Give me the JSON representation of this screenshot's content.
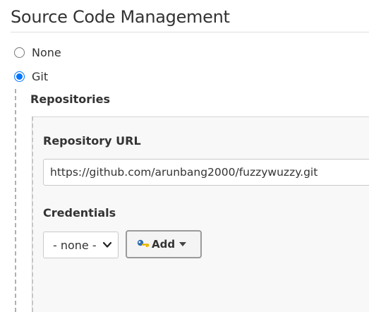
{
  "section": {
    "title": "Source Code Management"
  },
  "scm_options": {
    "none_label": "None",
    "git_label": "Git",
    "selected": "Git"
  },
  "git": {
    "repositories_heading": "Repositories",
    "repository_url": {
      "label": "Repository URL",
      "value": "https://github.com/arunbang2000/fuzzywuzzy.git"
    },
    "credentials": {
      "label": "Credentials",
      "selected": "- none -",
      "add_button_label": "Add",
      "add_button_icon": "key-icon"
    }
  },
  "colors": {
    "radio_accent": "#0075ff",
    "key_icon_blue": "#2f6fb7",
    "key_icon_yellow": "#e8b400"
  }
}
